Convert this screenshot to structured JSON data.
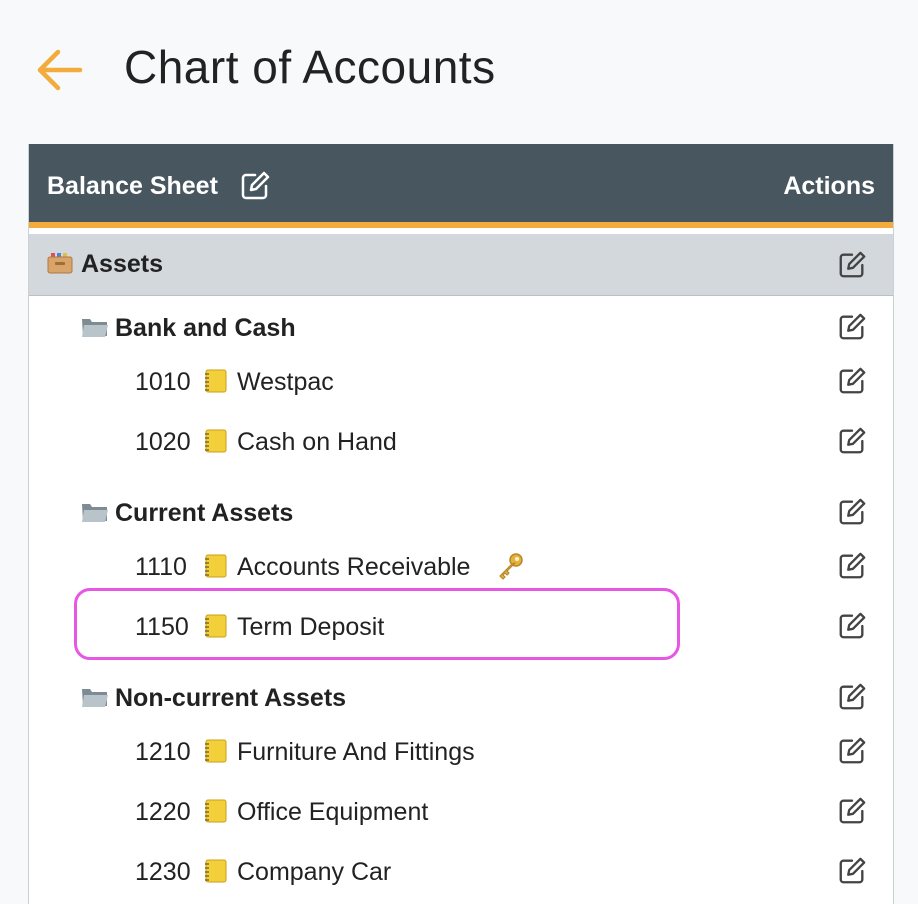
{
  "page": {
    "title": "Chart of Accounts",
    "back_icon": "arrow-left-icon",
    "accent_color": "#f3ab3c"
  },
  "panel": {
    "title": "Balance Sheet",
    "actions_label": "Actions",
    "header_color": "#48575f"
  },
  "group": {
    "label": "Assets",
    "icon": "file-box-icon"
  },
  "subgroups": [
    {
      "label": "Bank and Cash",
      "accounts": [
        {
          "code": "1010",
          "name": "Westpac"
        },
        {
          "code": "1020",
          "name": "Cash on Hand"
        }
      ]
    },
    {
      "label": "Current Assets",
      "accounts": [
        {
          "code": "1110",
          "name": "Accounts Receivable",
          "locked": true
        },
        {
          "code": "1150",
          "name": "Term Deposit",
          "highlighted": true
        }
      ]
    },
    {
      "label": "Non-current Assets",
      "accounts": [
        {
          "code": "1210",
          "name": "Furniture And Fittings"
        },
        {
          "code": "1220",
          "name": "Office Equipment"
        },
        {
          "code": "1230",
          "name": "Company Car"
        }
      ]
    }
  ],
  "highlight_color": "#e657e3"
}
